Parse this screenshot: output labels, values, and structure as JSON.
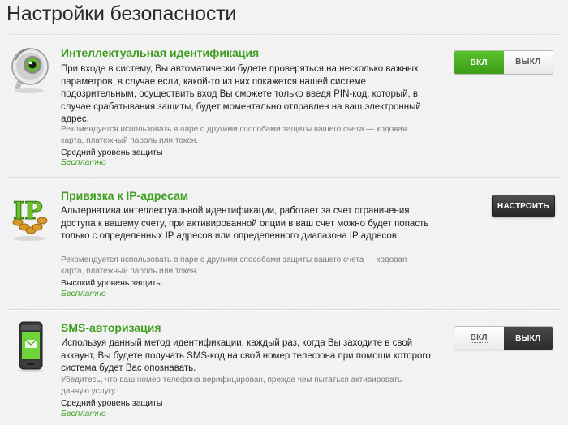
{
  "page": {
    "title": "Настройки безопасности"
  },
  "sections": [
    {
      "title": "Интеллектуальная идентификация",
      "icon": "eye-camera-icon",
      "description": "При входе в систему, Вы автоматически будете проверяться на несколько важных параметров, в случае если, какой-то из них покажется нашей системе подозрительным, осуществить вход Вы сможете только введя PIN-код, который, в случае срабатывания защиты, будет моментально отправлен на ваш электронный адрес.",
      "note": "Рекомендуется использовать в паре с другими способами защиты вашего счета — кодовая карта, платежный пароль или токен.",
      "level": "Средний уровень защиты",
      "price": "Бесплатно",
      "control": {
        "type": "toggle",
        "on_label": "ВКЛ",
        "off_label": "ВЫКЛ",
        "state": "on"
      }
    },
    {
      "title": "Привязка к IP-адресам",
      "icon": "ip-chain-icon",
      "icon_text": "IP",
      "description": "Альтернатива интеллектуальной идентификации, работает за счет ограничения доступа к вашему счету, при активированной опции в ваш счет можно будет попасть только с определенных IP адресов или определенного диапазона IP адресов.",
      "note": "Рекомендуется использовать в паре с другими способами защиты вашего счета — кодовая карта, платежный пароль или токен.",
      "level": "Высокий уровень защиты",
      "price": "Бесплатно",
      "control": {
        "type": "button",
        "label": "НАСТРОИТЬ"
      }
    },
    {
      "title": "SMS-авторизация",
      "icon": "mobile-phone-icon",
      "description": "Используя данный метод идентификации, каждый раз, когда Вы заходите в свой аккаунт, Вы будете получать SMS-код на свой номер телефона при помощи которого система будет Вас опознавать.",
      "note": "Убедитесь, что ваш номер телефона верифицирован, прежде чем пытаться активировать данную услугу.",
      "level": "Средний уровень защиты",
      "price": "Бесплатно",
      "control": {
        "type": "toggle",
        "on_label": "ВКЛ",
        "off_label": "ВЫКЛ",
        "state": "off"
      }
    }
  ],
  "colors": {
    "accent_green": "#3f9e20",
    "toggle_on": "#4caf23",
    "toggle_off_dark": "#2f2f2f"
  }
}
